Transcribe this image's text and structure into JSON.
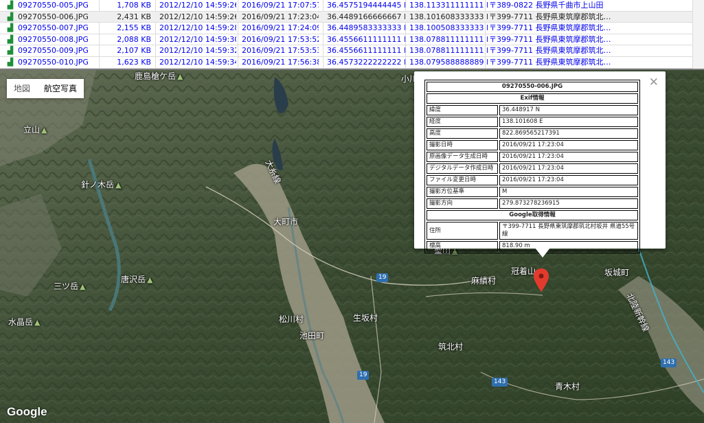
{
  "file_list": {
    "rows": [
      {
        "icon": "image-file-icon",
        "name": "09270550-005.JPG",
        "size": "1,708 KB",
        "date_taken": "2012/12/10 14:59:26",
        "date_modified": "2016/09/21 17:07:57",
        "lat": "36.4575194444445 N",
        "lon": "138.113311111111 E",
        "address": "〒389-0822 長野県千曲市上山田"
      },
      {
        "icon": "image-file-icon",
        "name": "09270550-006.JPG",
        "size": "2,431 KB",
        "date_taken": "2012/12/10 14:59:26",
        "date_modified": "2016/09/21 17:23:04",
        "lat": "36.4489166666667 N",
        "lon": "138.101608333333 E",
        "address": "〒399-7711 長野県東筑摩郡筑北…",
        "selected": true
      },
      {
        "icon": "image-file-icon",
        "name": "09270550-007.JPG",
        "size": "2,155 KB",
        "date_taken": "2012/12/10 14:59:28",
        "date_modified": "2016/09/21 17:24:09",
        "lat": "36.4489583333333 N",
        "lon": "138.100508333333 E",
        "address": "〒399-7711 長野県東筑摩郡筑北…"
      },
      {
        "icon": "image-file-icon",
        "name": "09270550-008.JPG",
        "size": "2,088 KB",
        "date_taken": "2012/12/10 14:59:30",
        "date_modified": "2016/09/21 17:53:52",
        "lat": "36.4556611111111 N",
        "lon": "138.078811111111 E",
        "address": "〒399-7711 長野県東筑摩郡筑北…"
      },
      {
        "icon": "image-file-icon",
        "name": "09270550-009.JPG",
        "size": "2,107 KB",
        "date_taken": "2012/12/10 14:59:32",
        "date_modified": "2016/09/21 17:53:53",
        "lat": "36.4556611111111 N",
        "lon": "138.078811111111 E",
        "address": "〒399-7711 長野県東筑摩郡筑北…"
      },
      {
        "icon": "image-file-icon",
        "name": "09270550-010.JPG",
        "size": "1,623 KB",
        "date_taken": "2012/12/10 14:59:34",
        "date_modified": "2016/09/21 17:56:38",
        "lat": "36.4573222222222 N",
        "lon": "138.079588888889 E",
        "address": "〒399-7711 長野県東筑摩郡筑北…"
      }
    ]
  },
  "map": {
    "type_buttons": [
      "地図",
      "航空写真"
    ],
    "active_type": "航空写真",
    "google_logo": "Google",
    "places": [
      {
        "name": "鹿島槍ケ岳",
        "mountain": true
      },
      {
        "name": "立山",
        "mountain": true
      },
      {
        "name": "針ノ木岳",
        "mountain": true
      },
      {
        "name": "三ツ岳",
        "mountain": true
      },
      {
        "name": "唐沢岳",
        "mountain": true
      },
      {
        "name": "水晶岳",
        "mountain": true
      },
      {
        "name": "大町市",
        "mountain": false
      },
      {
        "name": "松川村",
        "mountain": false
      },
      {
        "name": "池田町",
        "mountain": false
      },
      {
        "name": "生坂村",
        "mountain": false
      },
      {
        "name": "麻績村",
        "mountain": false
      },
      {
        "name": "冠着山",
        "mountain": true
      },
      {
        "name": "坂城町",
        "mountain": false
      },
      {
        "name": "筑北村",
        "mountain": false
      },
      {
        "name": "青木村",
        "mountain": false
      },
      {
        "name": "小川",
        "mountain": false
      },
      {
        "name": "聖山",
        "mountain": true
      },
      {
        "name": "大糸線",
        "mountain": false
      },
      {
        "name": "北陸新幹線",
        "mountain": false
      }
    ],
    "road_shields": [
      "19",
      "19",
      "143",
      "143"
    ],
    "mountain_icon": "mountain-icon",
    "marker_icon": "map-marker-icon"
  },
  "infowindow": {
    "title": "09270550-006.JPG",
    "exif_header": "Exif情報",
    "exif": [
      {
        "key": "緯度",
        "value": "36.448917 N"
      },
      {
        "key": "経度",
        "value": "138.101608 E"
      },
      {
        "key": "高度",
        "value": "822.869565217391"
      },
      {
        "key": "撮影日時",
        "value": "2016/09/21 17:23:04"
      },
      {
        "key": "原画像データ生成日時",
        "value": "2016/09/21 17:23:04"
      },
      {
        "key": "デジタルデータ作成日時",
        "value": "2016/09/21 17:23:04"
      },
      {
        "key": "ファイル変更日時",
        "value": "2016/09/21 17:23:04"
      },
      {
        "key": "撮影方位基準",
        "value": "M"
      },
      {
        "key": "撮影方向",
        "value": "279.873278236915"
      }
    ],
    "google_header": "Google取得情報",
    "google": [
      {
        "key": "住所",
        "value": "〒399-7711 長野県東筑摩郡筑北村坂井 県道55号線"
      },
      {
        "key": "標高",
        "value": "818.90 m"
      }
    ],
    "close_icon": "close-icon"
  },
  "colors": {
    "link_blue": "#0000ee",
    "selected_row": "#efefef",
    "marker_red": "#e23b2e"
  }
}
